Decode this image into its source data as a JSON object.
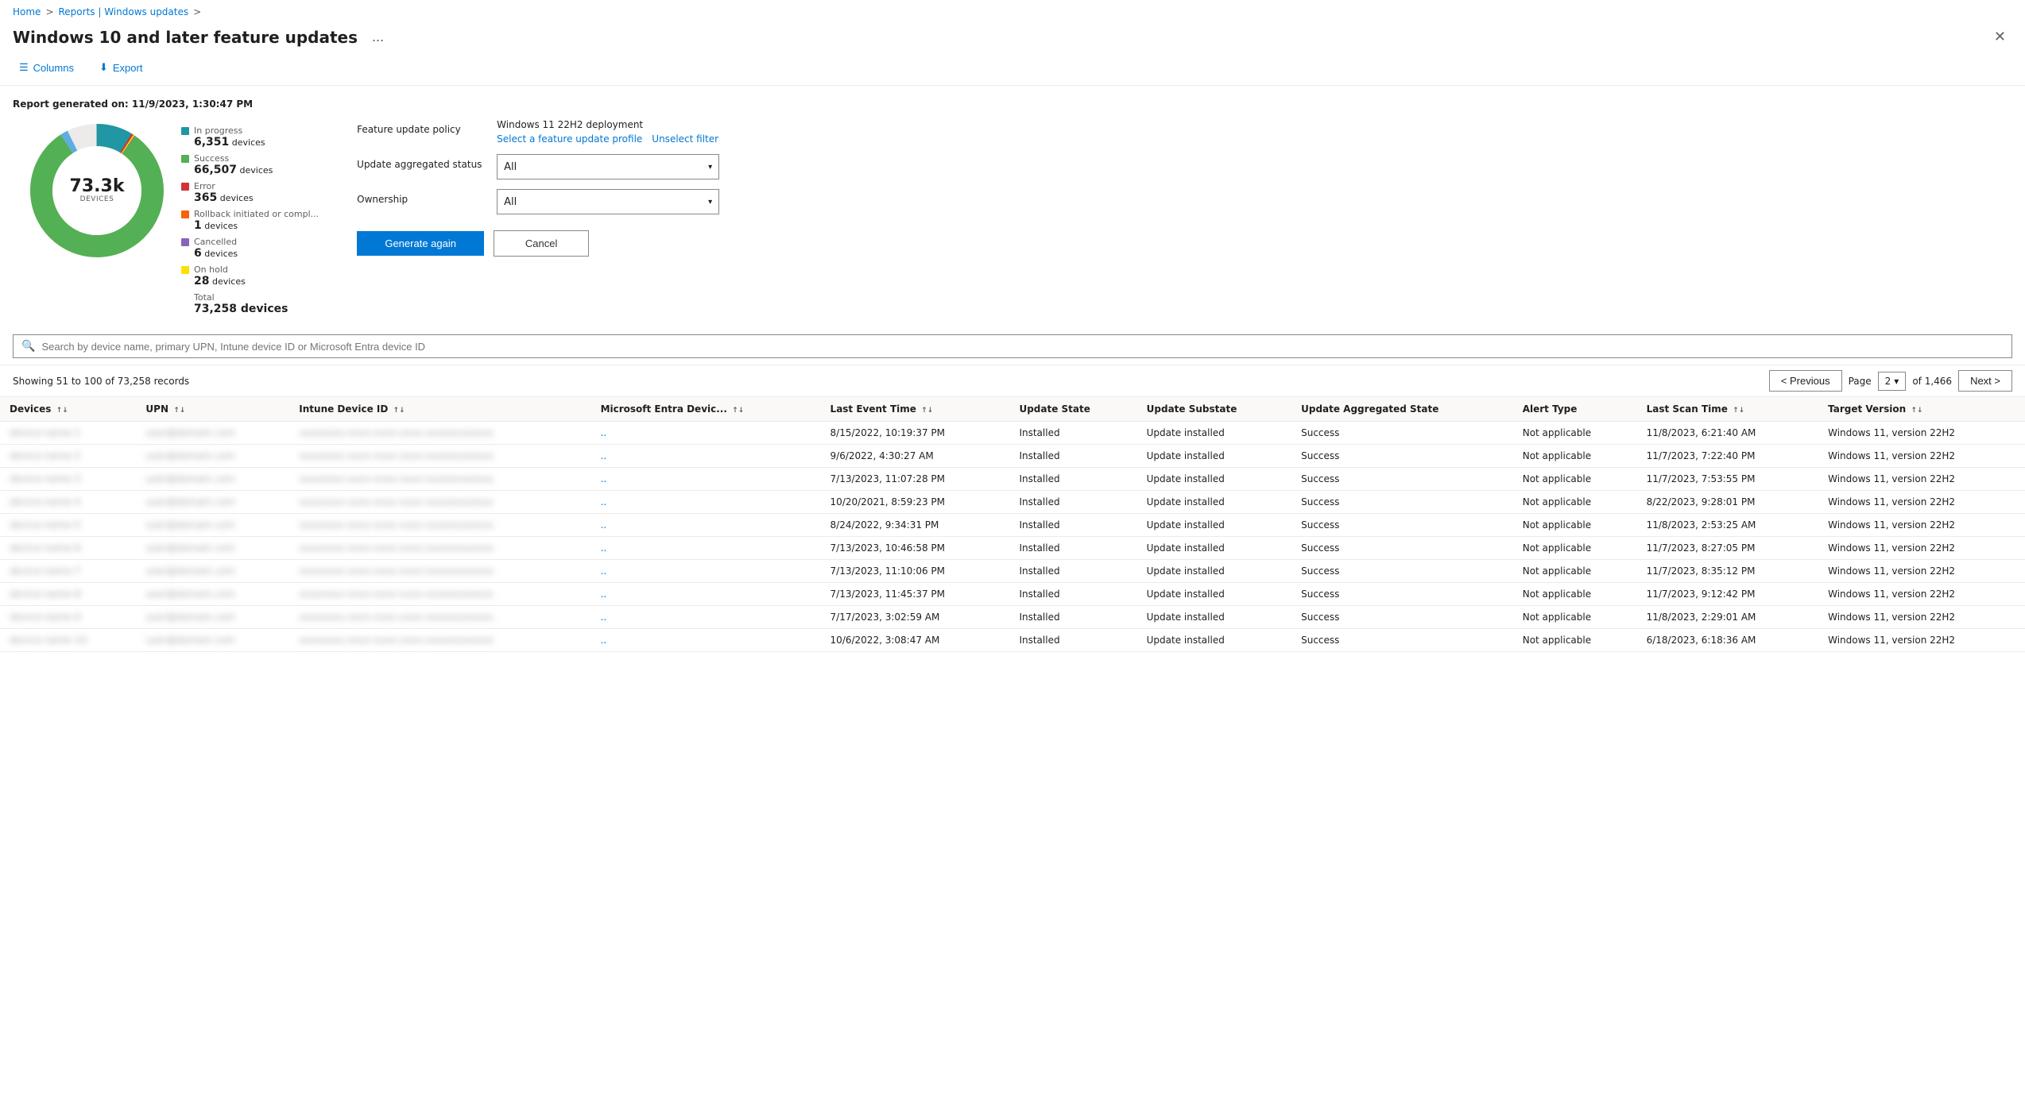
{
  "breadcrumb": {
    "home": "Home",
    "sep1": ">",
    "reports": "Reports | Windows updates",
    "sep2": ">"
  },
  "header": {
    "title": "Windows 10 and later feature updates",
    "ellipsis": "...",
    "close": "✕"
  },
  "toolbar": {
    "columns_label": "Columns",
    "export_label": "Export"
  },
  "report": {
    "generated_label": "Report generated on: 11/9/2023, 1:30:47 PM"
  },
  "donut": {
    "center_number": "73.3k",
    "center_label": "DEVICES",
    "total_label": "Total",
    "total_count": "73,258 devices"
  },
  "legend": [
    {
      "color": "#2196a4",
      "label": "In progress",
      "count": "6,351",
      "unit": "devices"
    },
    {
      "color": "#54b054",
      "label": "Success",
      "count": "66,507",
      "unit": "devices"
    },
    {
      "color": "#d13438",
      "label": "Error",
      "count": "365",
      "unit": "devices"
    },
    {
      "color": "#f7630c",
      "label": "Rollback initiated or compl...",
      "count": "1",
      "unit": "devices"
    },
    {
      "color": "#8764b8",
      "label": "Cancelled",
      "count": "6",
      "unit": "devices"
    },
    {
      "color": "#fce100",
      "label": "On hold",
      "count": "28",
      "unit": "devices"
    }
  ],
  "filters": {
    "feature_update_policy_label": "Feature update policy",
    "feature_update_policy_value": "Windows 11 22H2 deployment",
    "select_profile_link": "Select a feature update profile",
    "unselect_filter_link": "Unselect filter",
    "update_aggregated_status_label": "Update aggregated status",
    "update_aggregated_status_value": "All",
    "ownership_label": "Ownership",
    "ownership_value": "All",
    "generate_again_label": "Generate again",
    "cancel_label": "Cancel"
  },
  "search": {
    "placeholder": "Search by device name, primary UPN, Intune device ID or Microsoft Entra device ID"
  },
  "pagination": {
    "records_text": "Showing 51 to 100 of 73,258 records",
    "prev_label": "< Previous",
    "next_label": "Next >",
    "page_label": "Page",
    "page_number": "2",
    "of_label": "of 1,466"
  },
  "table": {
    "columns": [
      {
        "key": "devices",
        "label": "Devices",
        "sortable": true
      },
      {
        "key": "upn",
        "label": "UPN",
        "sortable": true
      },
      {
        "key": "intune_device_id",
        "label": "Intune Device ID",
        "sortable": true
      },
      {
        "key": "ms_entra_device",
        "label": "Microsoft Entra Devic...",
        "sortable": true
      },
      {
        "key": "last_event_time",
        "label": "Last Event Time",
        "sortable": true
      },
      {
        "key": "update_state",
        "label": "Update State",
        "sortable": false
      },
      {
        "key": "update_substate",
        "label": "Update Substate",
        "sortable": false
      },
      {
        "key": "update_aggregated_state",
        "label": "Update Aggregated State",
        "sortable": false
      },
      {
        "key": "alert_type",
        "label": "Alert Type",
        "sortable": false
      },
      {
        "key": "last_scan_time",
        "label": "Last Scan Time",
        "sortable": true
      },
      {
        "key": "target_version",
        "label": "Target Version",
        "sortable": true
      }
    ],
    "rows": [
      {
        "devices": "BLURRED",
        "upn": "BLURRED",
        "intune_device_id": "BLURRED",
        "ms_entra_device": "..",
        "last_event_time": "8/15/2022, 10:19:37 PM",
        "update_state": "Installed",
        "update_substate": "Update installed",
        "update_aggregated_state": "Success",
        "alert_type": "Not applicable",
        "last_scan_time": "11/8/2023, 6:21:40 AM",
        "target_version": "Windows 11, version 22H2"
      },
      {
        "devices": "BLURRED",
        "upn": "BLURRED",
        "intune_device_id": "BLURRED",
        "ms_entra_device": "..",
        "last_event_time": "9/6/2022, 4:30:27 AM",
        "update_state": "Installed",
        "update_substate": "Update installed",
        "update_aggregated_state": "Success",
        "alert_type": "Not applicable",
        "last_scan_time": "11/7/2023, 7:22:40 PM",
        "target_version": "Windows 11, version 22H2"
      },
      {
        "devices": "BLURRED",
        "upn": "BLURRED",
        "intune_device_id": "BLURRED",
        "ms_entra_device": "..",
        "last_event_time": "7/13/2023, 11:07:28 PM",
        "update_state": "Installed",
        "update_substate": "Update installed",
        "update_aggregated_state": "Success",
        "alert_type": "Not applicable",
        "last_scan_time": "11/7/2023, 7:53:55 PM",
        "target_version": "Windows 11, version 22H2"
      },
      {
        "devices": "BLURRED",
        "upn": "BLURRED",
        "intune_device_id": "BLURRED",
        "ms_entra_device": "..",
        "last_event_time": "10/20/2021, 8:59:23 PM",
        "update_state": "Installed",
        "update_substate": "Update installed",
        "update_aggregated_state": "Success",
        "alert_type": "Not applicable",
        "last_scan_time": "8/22/2023, 9:28:01 PM",
        "target_version": "Windows 11, version 22H2"
      },
      {
        "devices": "BLURRED",
        "upn": "BLURRED",
        "intune_device_id": "BLURRED",
        "ms_entra_device": "..",
        "last_event_time": "8/24/2022, 9:34:31 PM",
        "update_state": "Installed",
        "update_substate": "Update installed",
        "update_aggregated_state": "Success",
        "alert_type": "Not applicable",
        "last_scan_time": "11/8/2023, 2:53:25 AM",
        "target_version": "Windows 11, version 22H2"
      },
      {
        "devices": "BLURRED",
        "upn": "BLURRED",
        "intune_device_id": "BLURRED",
        "ms_entra_device": "..",
        "last_event_time": "7/13/2023, 10:46:58 PM",
        "update_state": "Installed",
        "update_substate": "Update installed",
        "update_aggregated_state": "Success",
        "alert_type": "Not applicable",
        "last_scan_time": "11/7/2023, 8:27:05 PM",
        "target_version": "Windows 11, version 22H2"
      },
      {
        "devices": "BLURRED",
        "upn": "BLURRED",
        "intune_device_id": "BLURRED",
        "ms_entra_device": "..",
        "last_event_time": "7/13/2023, 11:10:06 PM",
        "update_state": "Installed",
        "update_substate": "Update installed",
        "update_aggregated_state": "Success",
        "alert_type": "Not applicable",
        "last_scan_time": "11/7/2023, 8:35:12 PM",
        "target_version": "Windows 11, version 22H2"
      },
      {
        "devices": "BLURRED",
        "upn": "BLURRED",
        "intune_device_id": "BLURRED",
        "ms_entra_device": "..",
        "last_event_time": "7/13/2023, 11:45:37 PM",
        "update_state": "Installed",
        "update_substate": "Update installed",
        "update_aggregated_state": "Success",
        "alert_type": "Not applicable",
        "last_scan_time": "11/7/2023, 9:12:42 PM",
        "target_version": "Windows 11, version 22H2"
      },
      {
        "devices": "BLURRED",
        "upn": "BLURRED",
        "intune_device_id": "BLURRED",
        "ms_entra_device": "..",
        "last_event_time": "7/17/2023, 3:02:59 AM",
        "update_state": "Installed",
        "update_substate": "Update installed",
        "update_aggregated_state": "Success",
        "alert_type": "Not applicable",
        "last_scan_time": "11/8/2023, 2:29:01 AM",
        "target_version": "Windows 11, version 22H2"
      },
      {
        "devices": "BLURRED",
        "upn": "BLURRED",
        "intune_device_id": "BLURRED",
        "ms_entra_device": "..",
        "last_event_time": "10/6/2022, 3:08:47 AM",
        "update_state": "Installed",
        "update_substate": "Update installed",
        "update_aggregated_state": "Success",
        "alert_type": "Not applicable",
        "last_scan_time": "6/18/2023, 6:18:36 AM",
        "target_version": "Windows 11, version 22H2"
      }
    ]
  }
}
